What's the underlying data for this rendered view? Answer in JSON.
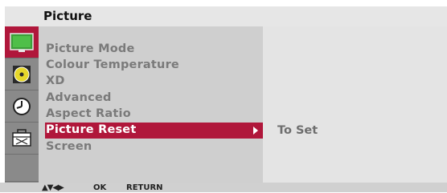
{
  "header": {
    "title": "Picture"
  },
  "sidebar": {
    "icons": [
      {
        "name": "picture-icon",
        "active": true
      },
      {
        "name": "audio-disc-icon",
        "active": false
      },
      {
        "name": "clock-icon",
        "active": false
      },
      {
        "name": "option-toolbox-icon",
        "active": false
      }
    ]
  },
  "menu": {
    "items": [
      {
        "label": "Picture Mode"
      },
      {
        "label": "Colour Temperature"
      },
      {
        "label": "XD"
      },
      {
        "label": "Advanced"
      },
      {
        "label": "Aspect Ratio"
      },
      {
        "label": "Picture Reset",
        "selected": true
      },
      {
        "label": "Screen"
      }
    ]
  },
  "submenu": {
    "value": "To Set"
  },
  "footer": {
    "nav_glyphs": "▲▼◀▶",
    "ok_label": "OK",
    "return_label": "RETURN"
  },
  "colors": {
    "accent": "#b0173b",
    "sidebar": "#8a8a8a",
    "panel": "#cfcfcf",
    "option_panel": "#e4e4e4",
    "title_bar": "#e6e6e6"
  }
}
